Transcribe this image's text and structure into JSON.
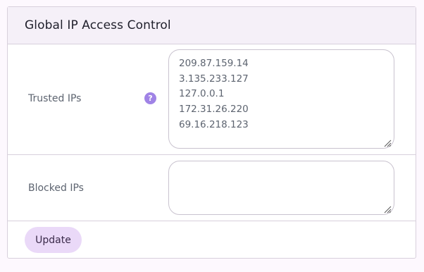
{
  "card": {
    "title": "Global IP Access Control"
  },
  "trusted": {
    "label": "Trusted IPs",
    "help_icon": "question-mark-icon",
    "help_glyph": "?",
    "value": "209.87.159.14\n3.135.233.127\n127.0.0.1\n172.31.26.220\n69.16.218.123"
  },
  "blocked": {
    "label": "Blocked IPs",
    "value": ""
  },
  "actions": {
    "update_label": "Update"
  },
  "colors": {
    "accent": "#a083e6",
    "button_bg": "#ead9f8",
    "header_bg": "#f5f0f8"
  }
}
